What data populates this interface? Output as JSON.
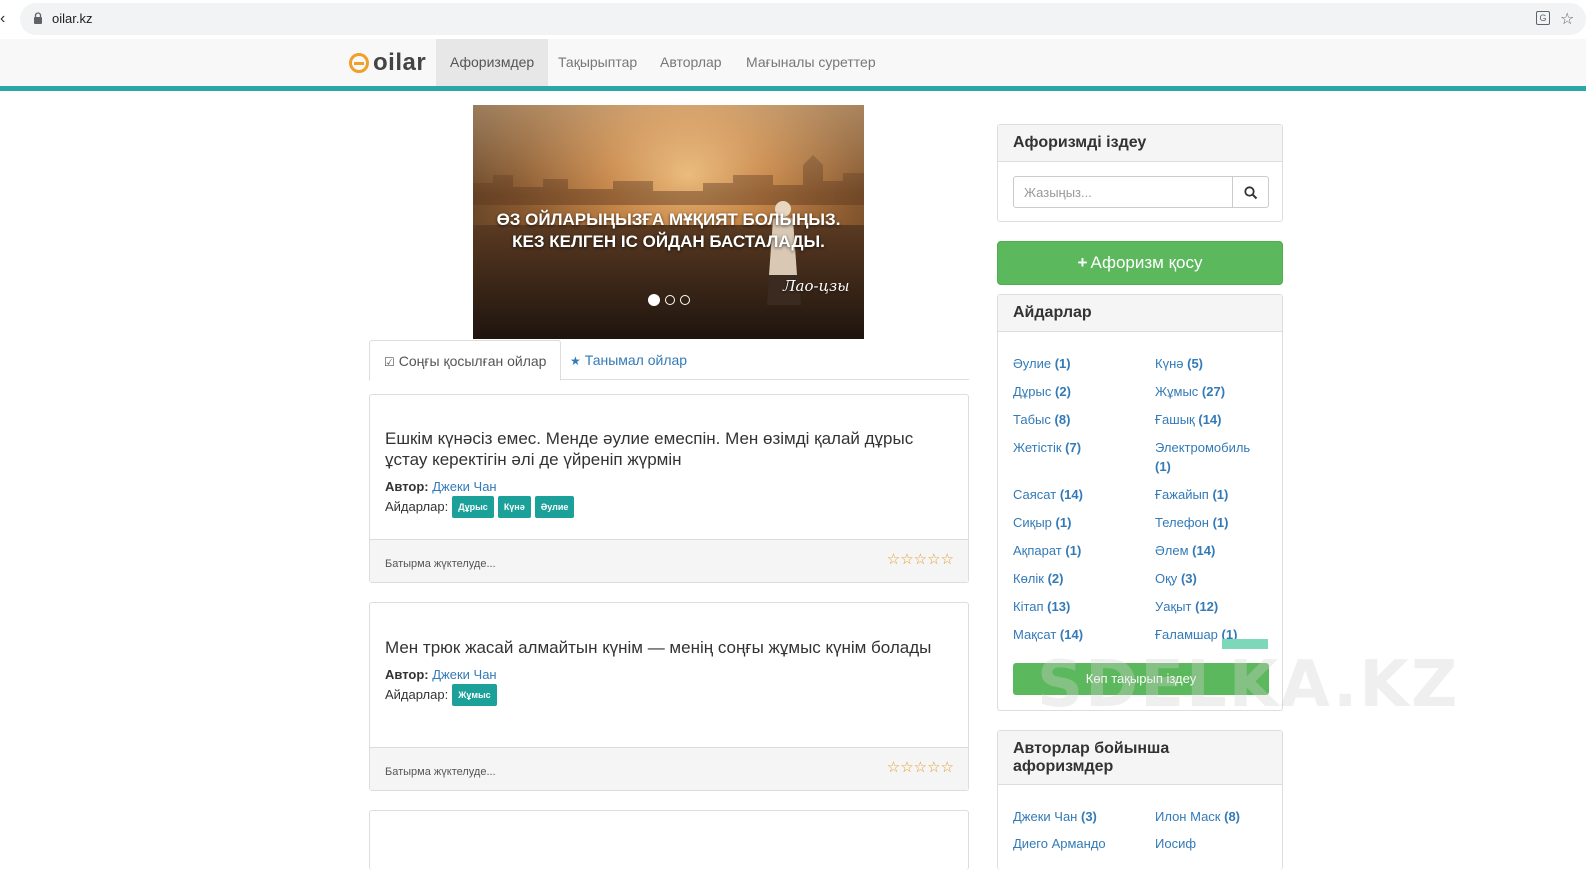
{
  "browser": {
    "url": "oilar.kz",
    "translate_icon": "translate-icon",
    "bookmark_icon": "star-outline-icon"
  },
  "site": {
    "logo_text": "oilar",
    "nav": [
      {
        "label": "Афоризмдер",
        "active": true
      },
      {
        "label": "Тақырыптар",
        "active": false
      },
      {
        "label": "Авторлар",
        "active": false
      },
      {
        "label": "Мағыналы суреттер",
        "active": false
      }
    ],
    "accent_color": "#2aa7a7"
  },
  "slider": {
    "quote_line1": "ӨЗ ОЙЛАРЫҢЫЗҒА МҰҚИЯТ БОЛЫҢЫЗ.",
    "quote_line2": "КЕЗ КЕЛГЕН ІС ОЙДАН БАСТАЛАДЫ.",
    "author": "Лао-цзы",
    "active_slide": 1,
    "slide_count": 3
  },
  "tabs": {
    "recent": "Соңғы қосылған ойлар",
    "popular": "Танымал ойлар"
  },
  "quotes": [
    {
      "text": "Ешкім күнәсіз емес. Менде әулие емеспін. Мен өзімді қалай дұрыс ұстау керектігін әлі де үйреніп жүрмін",
      "author_label": "Автор:",
      "author": "Джеки Чан",
      "tags_label": "Айдарлар:",
      "tags": [
        "Дұрыс",
        "Күнә",
        "Әулие"
      ],
      "footer": "Батырма жүктелуде...",
      "rating": "☆☆☆☆☆"
    },
    {
      "text": "Мен трюк жасай алмайтын күнім — менің соңғы жұмыс күнім болады",
      "author_label": "Автор:",
      "author": "Джеки Чан",
      "tags_label": "Айдарлар:",
      "tags": [
        "Жұмыс"
      ],
      "footer": "Батырма жүктелуде...",
      "rating": "☆☆☆☆☆"
    }
  ],
  "sidebar": {
    "search_title": "Афоризмді іздеу",
    "search_placeholder": "Жазыңыз...",
    "add_button": "Афоризм қосу",
    "add_plus": "+",
    "categories_title": "Айдарлар",
    "categories": [
      {
        "name": "Әулие",
        "count": "(1)"
      },
      {
        "name": "Күнә",
        "count": "(5)"
      },
      {
        "name": "Дұрыс",
        "count": "(2)"
      },
      {
        "name": "Жұмыс",
        "count": "(27)"
      },
      {
        "name": "Табыс",
        "count": "(8)"
      },
      {
        "name": "Ғашық",
        "count": "(14)"
      },
      {
        "name": "Жетістік",
        "count": "(7)"
      },
      {
        "name": "Электромобиль",
        "count": "(1)"
      },
      {
        "name": "Саясат",
        "count": "(14)"
      },
      {
        "name": "Ғажайып",
        "count": "(1)"
      },
      {
        "name": "Сиқыр",
        "count": "(1)"
      },
      {
        "name": "Телефон",
        "count": "(1)"
      },
      {
        "name": "Ақпарат",
        "count": "(1)"
      },
      {
        "name": "Әлем",
        "count": "(14)"
      },
      {
        "name": "Көлік",
        "count": "(2)"
      },
      {
        "name": "Оқу",
        "count": "(3)"
      },
      {
        "name": "Кітап",
        "count": "(13)"
      },
      {
        "name": "Уақыт",
        "count": "(12)"
      },
      {
        "name": "Мақсат",
        "count": "(14)"
      },
      {
        "name": "Ғаламшар",
        "count": "(1)"
      }
    ],
    "more_button": "Көп тақырып іздеу",
    "authors_title_line1": "Авторлар бойынша",
    "authors_title_line2": "афоризмдер",
    "authors": [
      {
        "name": "Джеки Чан",
        "count": "(3)"
      },
      {
        "name": "Илон Маск",
        "count": "(8)"
      },
      {
        "name": "Диего Армандо",
        "count": ""
      },
      {
        "name": "Иосиф",
        "count": ""
      }
    ]
  },
  "watermark": "SDELKA.KZ"
}
